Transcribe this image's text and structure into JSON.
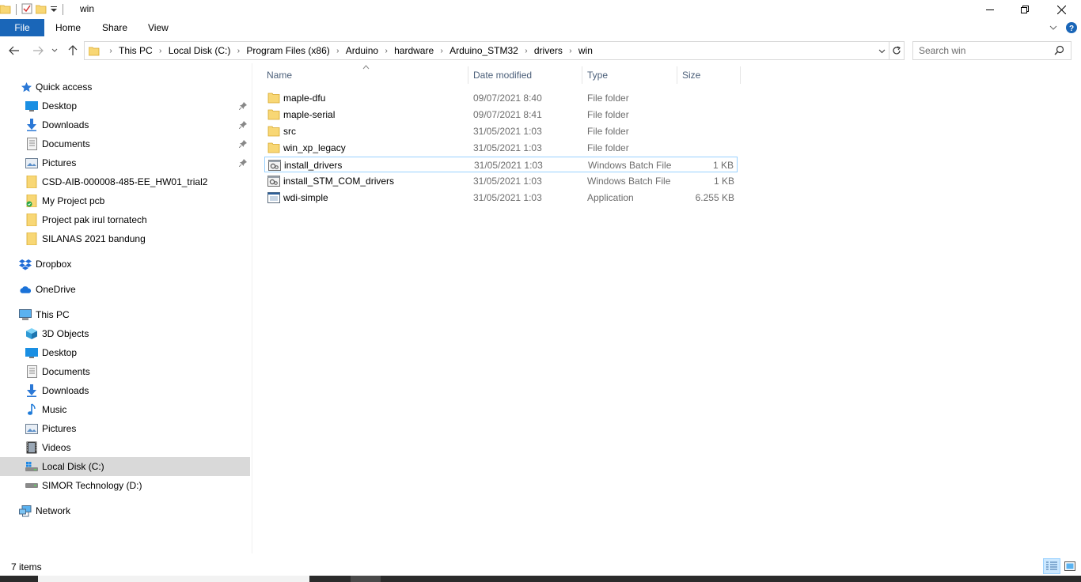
{
  "window": {
    "title": "win",
    "minimize_label": "Minimize",
    "maximize_label": "Restore Down",
    "close_label": "Close"
  },
  "ribbon": {
    "tabs": [
      "File",
      "Home",
      "Share",
      "View"
    ]
  },
  "address": {
    "crumbs": [
      "This PC",
      "Local Disk (C:)",
      "Program Files (x86)",
      "Arduino",
      "hardware",
      "Arduino_STM32",
      "drivers",
      "win"
    ]
  },
  "search": {
    "placeholder": "Search win"
  },
  "nav": {
    "quick_access": "Quick access",
    "quick_items": [
      "Desktop",
      "Downloads",
      "Documents",
      "Pictures",
      "CSD-AIB-000008-485-EE_HW01_trial2",
      "My Project pcb",
      "Project pak irul tornatech",
      "SILANAS 2021 bandung"
    ],
    "dropbox": "Dropbox",
    "onedrive": "OneDrive",
    "this_pc": "This PC",
    "pc_items": [
      "3D Objects",
      "Desktop",
      "Documents",
      "Downloads",
      "Music",
      "Pictures",
      "Videos",
      "Local Disk (C:)",
      "SIMOR Technology (D:)"
    ],
    "network": "Network"
  },
  "columns": {
    "name": "Name",
    "date": "Date modified",
    "type": "Type",
    "size": "Size"
  },
  "files": [
    {
      "name": "maple-dfu",
      "date": "09/07/2021 8:40",
      "type": "File folder",
      "size": "",
      "icon": "folder-icon"
    },
    {
      "name": "maple-serial",
      "date": "09/07/2021 8:41",
      "type": "File folder",
      "size": "",
      "icon": "folder-icon"
    },
    {
      "name": "src",
      "date": "31/05/2021 1:03",
      "type": "File folder",
      "size": "",
      "icon": "folder-icon"
    },
    {
      "name": "win_xp_legacy",
      "date": "31/05/2021 1:03",
      "type": "File folder",
      "size": "",
      "icon": "folder-icon"
    },
    {
      "name": "install_drivers",
      "date": "31/05/2021 1:03",
      "type": "Windows Batch File",
      "size": "1 KB",
      "icon": "batch-file-icon"
    },
    {
      "name": "install_STM_COM_drivers",
      "date": "31/05/2021 1:03",
      "type": "Windows Batch File",
      "size": "1 KB",
      "icon": "batch-file-icon"
    },
    {
      "name": "wdi-simple",
      "date": "31/05/2021 1:03",
      "type": "Application",
      "size": "6.255 KB",
      "icon": "application-icon"
    }
  ],
  "status": {
    "item_count": "7 items"
  },
  "colors": {
    "accent": "#1a66b8",
    "folder": "#f8d775",
    "selection": "#d9d9d9",
    "focus_border": "#99d1ff"
  }
}
